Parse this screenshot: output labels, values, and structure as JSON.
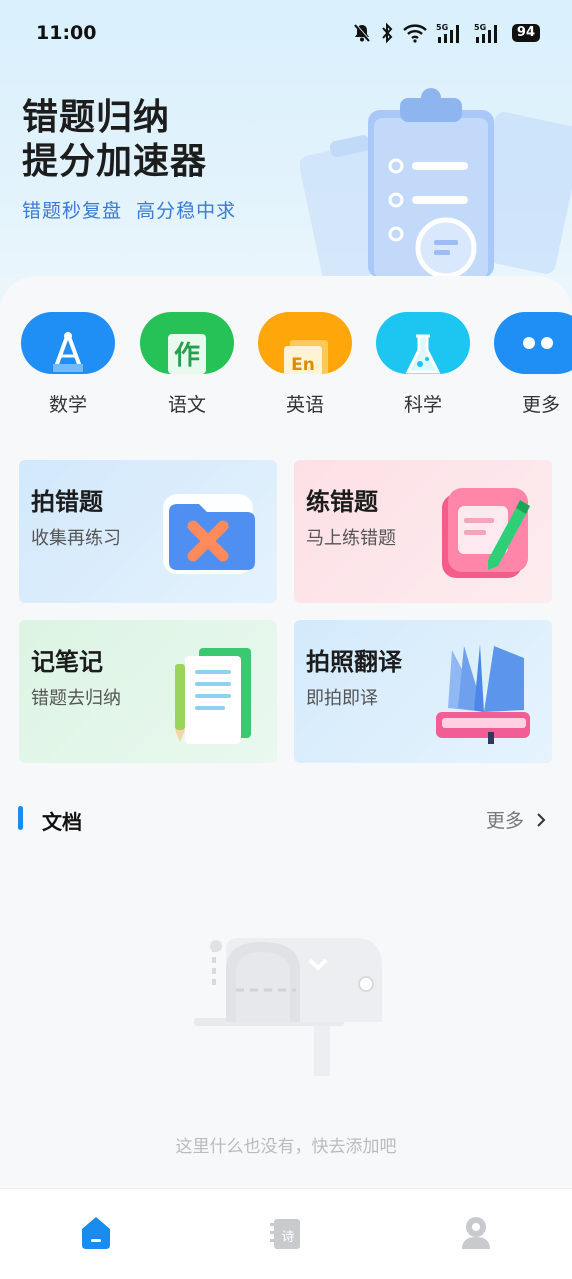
{
  "status": {
    "time": "11:00",
    "battery": "94",
    "icons": [
      "bell-off-icon",
      "bluetooth-icon",
      "wifi-icon",
      "signal-5g-icon",
      "signal-5g-icon"
    ]
  },
  "hero": {
    "title_line1": "错题归纳",
    "title_line2": "提分加速器",
    "subtitle": "错题秒复盘  高分稳中求"
  },
  "subjects": [
    {
      "label": "数学",
      "icon": "compass-icon",
      "color": "#1f8ff5"
    },
    {
      "label": "语文",
      "icon": "zuo-character-icon",
      "color": "#27c257"
    },
    {
      "label": "英语",
      "icon": "en-book-icon",
      "color": "#ffa60a"
    },
    {
      "label": "科学",
      "icon": "flask-icon",
      "color": "#1cc6f0"
    },
    {
      "label": "更多",
      "icon": "more-dots-icon",
      "color": "#1f8ff5"
    }
  ],
  "features": [
    {
      "title": "拍错题",
      "subtitle": "收集再练习",
      "bg": "#d5ebfb",
      "icon": "folder-x-icon"
    },
    {
      "title": "练错题",
      "subtitle": "马上练错题",
      "bg": "#fde3e8",
      "icon": "notebook-pen-icon"
    },
    {
      "title": "记笔记",
      "subtitle": "错题去归纳",
      "bg": "#def5e6",
      "icon": "note-pen-icon"
    },
    {
      "title": "拍照翻译",
      "subtitle": "即拍即译",
      "bg": "#d6ecfb",
      "icon": "open-book-icon"
    }
  ],
  "documents": {
    "title": "文档",
    "more": "更多",
    "empty_text": "这里什么也没有，快去添加吧"
  },
  "tabbar": {
    "items": [
      {
        "name": "home",
        "icon": "home-icon",
        "active": true
      },
      {
        "name": "poem",
        "icon": "poem-book-icon",
        "active": false,
        "glyph": "诗"
      },
      {
        "name": "profile",
        "icon": "user-icon",
        "active": false
      }
    ],
    "accent": "#1a8cf0"
  }
}
